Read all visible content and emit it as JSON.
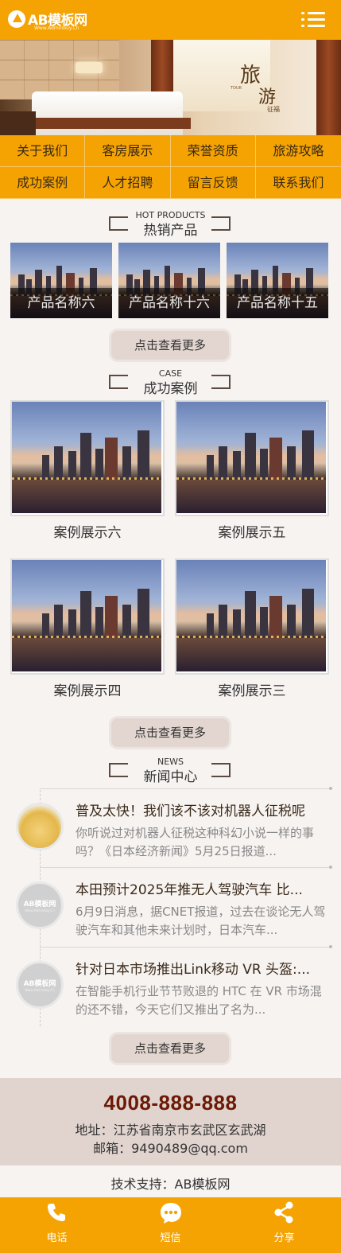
{
  "header": {
    "logo_text": "AB模板网",
    "logo_sub": "Www.Adminbuy.Cn",
    "menu_icon": "hamburger-menu-icon",
    "accent_color": "#f5a303"
  },
  "banner": {
    "calligraphy_1": "旅",
    "calligraphy_2": "游",
    "calligraphy_small": "TOUR",
    "signature": "征福"
  },
  "nav": {
    "items": [
      "关于我们",
      "客房展示",
      "荣誉资质",
      "旅游攻略",
      "成功案例",
      "人才招聘",
      "留言反馈",
      "联系我们"
    ]
  },
  "hot_products": {
    "title_en": "HOT PRODUCTS",
    "title_cn": "热销产品",
    "items": [
      "产品名称六",
      "产品名称十六",
      "产品名称十五"
    ],
    "more": "点击查看更多"
  },
  "cases": {
    "title_en": "CASE",
    "title_cn": "成功案例",
    "items": [
      "案例展示六",
      "案例展示五",
      "案例展示四",
      "案例展示三"
    ],
    "more": "点击查看更多"
  },
  "news": {
    "title_en": "NEWS",
    "title_cn": "新闻中心",
    "thumb_logo": "AB模板网",
    "thumb_sub": "Www.Adminbuy.Cn",
    "items": [
      {
        "title": "普及太快！我们该不该对机器人征税呢",
        "desc": "你听说过对机器人征税这种科幻小说一样的事吗？《日本经济新闻》5月25日报道..."
      },
      {
        "title": "本田预计2025年推无人驾驶汽车 比...",
        "desc": "6月9日消息，据CNET报道，过去在谈论无人驾驶汽车和其他未来计划时，日本汽车..."
      },
      {
        "title": "针对日本市场推出Link移动 VR 头盔:...",
        "desc": "在智能手机行业节节败退的 HTC 在 VR 市场混的还不错，今天它们又推出了名为..."
      }
    ],
    "more": "点击查看更多"
  },
  "contact": {
    "phone": "4008-888-888",
    "address": "地址：江苏省南京市玄武区玄武湖",
    "email": "邮箱：9490489@qq.com"
  },
  "support": "技术支持：AB模板网",
  "bottom_bar": {
    "items": [
      {
        "label": "电话",
        "icon": "phone-icon"
      },
      {
        "label": "短信",
        "icon": "message-icon"
      },
      {
        "label": "分享",
        "icon": "share-icon"
      }
    ]
  }
}
